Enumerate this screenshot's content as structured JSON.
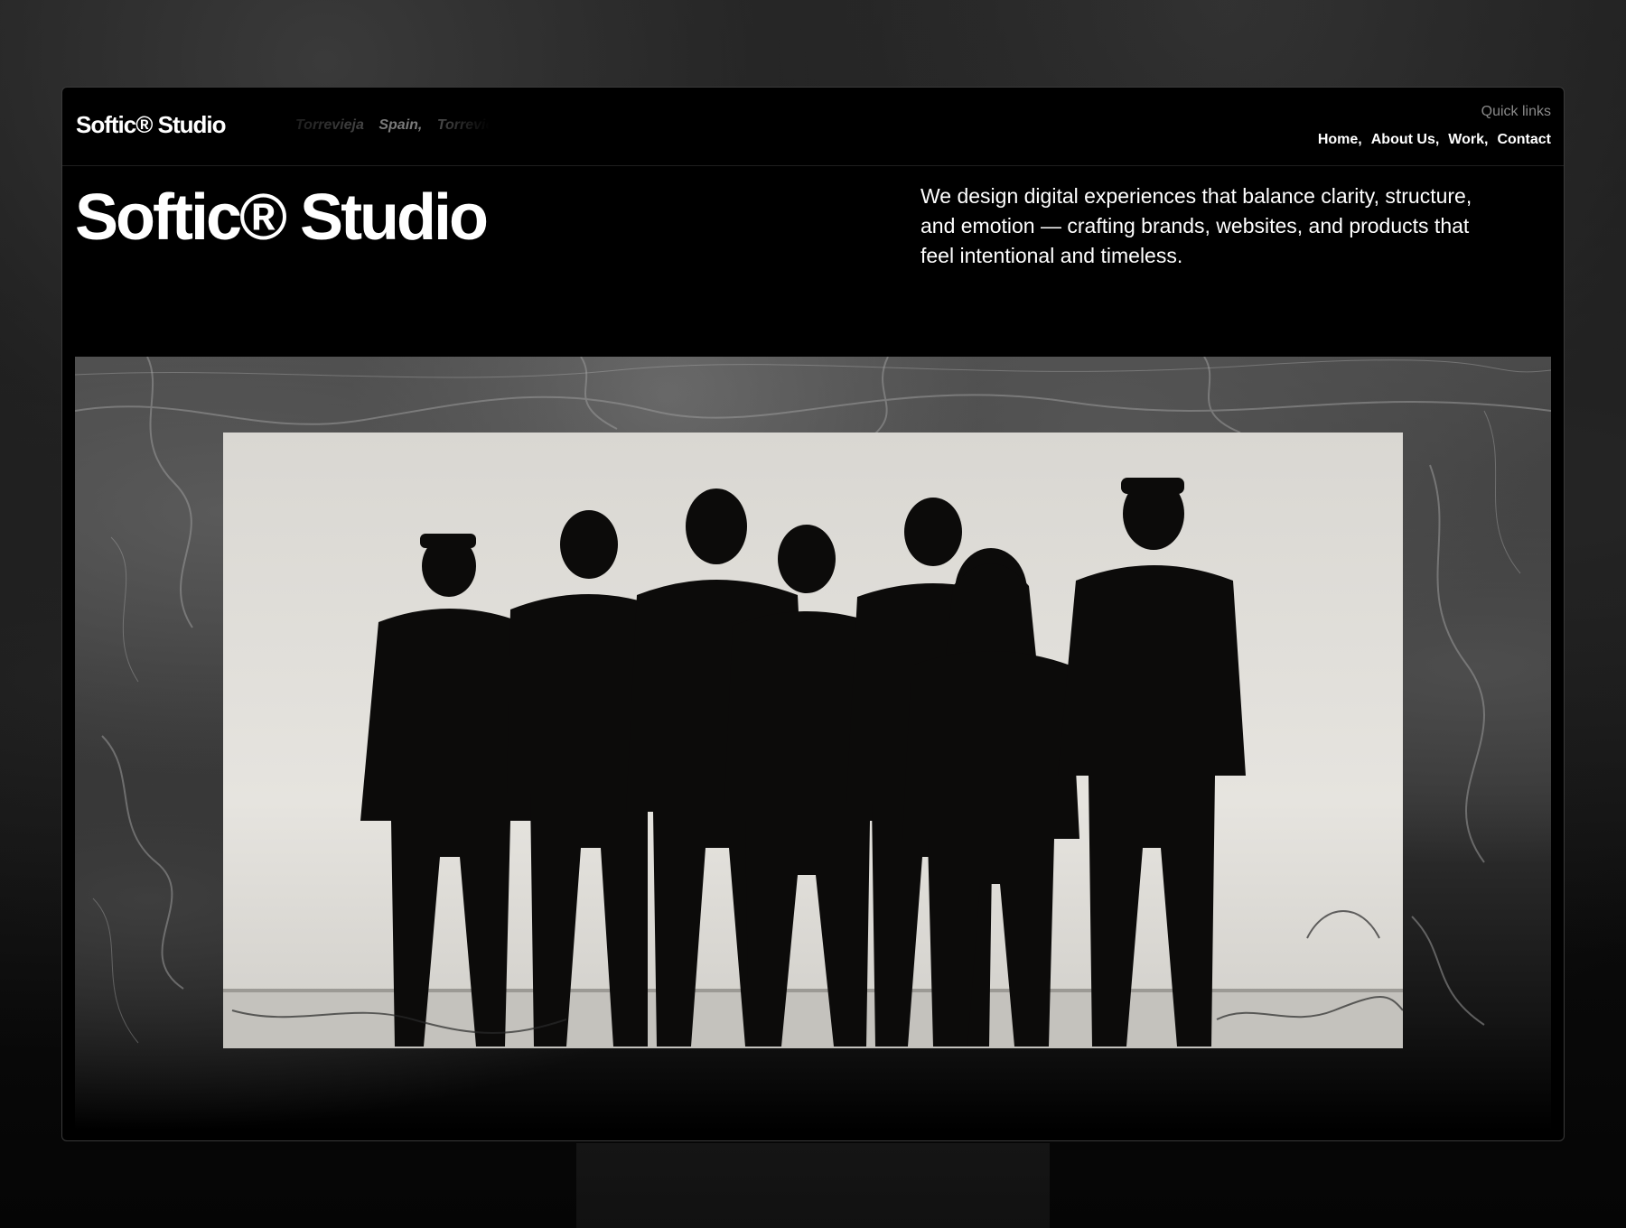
{
  "nav": {
    "logo": "Softic® Studio",
    "ticker": [
      "Torrevieja",
      "Spain,",
      "Torrevieja"
    ],
    "quick_links_title": "Quick links",
    "links": [
      "Home,",
      "About Us,",
      "Work,",
      "Contact"
    ]
  },
  "hero": {
    "title": "Softic® Studio",
    "description": "We design digital experiences that balance clarity, structure, and emotion — crafting brands, websites, and products that feel intentional and timeless."
  },
  "colors": {
    "background": "#000000",
    "text": "#ffffff",
    "muted": "#8a8a8a"
  }
}
